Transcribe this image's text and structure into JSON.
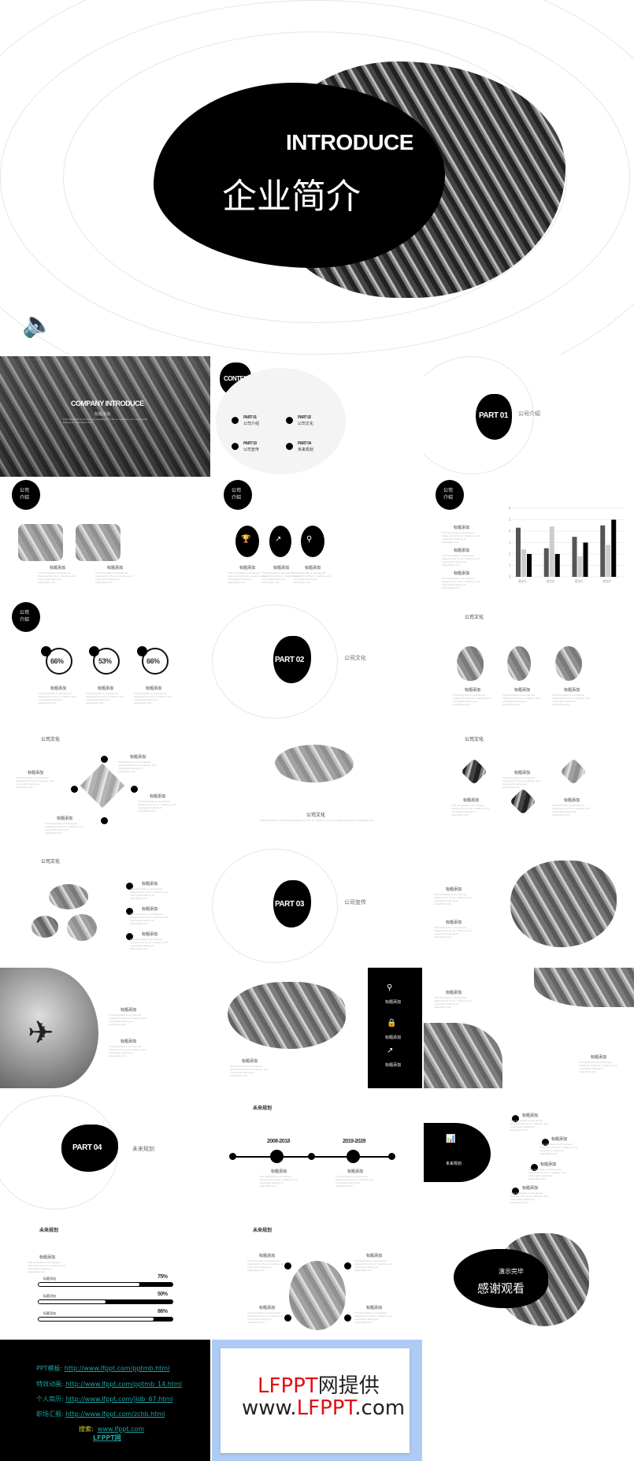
{
  "hero": {
    "title_en": "INTRODUCE",
    "title_cn": "企业简介",
    "speaker_icon": "speaker-icon"
  },
  "body_text": "This template is exclusively designed by Fei er creative, and copyrights belong to www.lfppt.com.",
  "add_title": "标题添加",
  "s1": {
    "title": "COMPANY INTRODUCE",
    "sub": "标题添加"
  },
  "s2": {
    "title": "CONTENT",
    "items": [
      {
        "part": "PART 01",
        "name": "公司介绍"
      },
      {
        "part": "PART 02",
        "name": "公司文化"
      },
      {
        "part": "PART 03",
        "name": "公司宣传"
      },
      {
        "part": "PART 04",
        "name": "未来规划"
      }
    ]
  },
  "s3": {
    "part": "PART 01",
    "name": "公司介绍"
  },
  "section_intro": "公司介绍",
  "s10": {
    "progress": [
      "66%",
      "53%",
      "66%"
    ]
  },
  "s11": {
    "part": "PART 02",
    "name": "公司文化"
  },
  "culture": "公司文化",
  "s17": {
    "part": "PART 03",
    "name": "公司宣传"
  },
  "s22": {
    "part": "PART 04",
    "name": "未来规划"
  },
  "future": "未来规划",
  "s23": {
    "years": [
      "2008-2018",
      "2019-2029"
    ]
  },
  "s24": {
    "label": "未来规划"
  },
  "s25": {
    "bars": [
      {
        "label": "标题添加",
        "value": "75%",
        "fraction": 0.75
      },
      {
        "label": "标题添加",
        "value": "50%",
        "fraction": 0.5
      },
      {
        "label": "标题添加",
        "value": "86%",
        "fraction": 0.86
      }
    ]
  },
  "s27": {
    "line1": "演示完毕",
    "line2": "感谢观看"
  },
  "links": [
    {
      "label": "PPT模板",
      "url": "http://www.lfppt.com/pptmb.html"
    },
    {
      "label": "特效动画",
      "url": "http://www.lfppt.com/pptmb_14.html"
    },
    {
      "label": "个人简历",
      "url": "http://www.lfppt.com/jldb_67.html"
    },
    {
      "label": "职场汇报",
      "url": "http://www.lfppt.com/zchb.html"
    }
  ],
  "search": {
    "label": "搜索:",
    "url": "www.lfppt.com",
    "site": "LFPPT网"
  },
  "brand": {
    "line1_red": "LFPPT",
    "line1_black": "网提供",
    "line2_pre": "www.",
    "line2_red": "LFPPT",
    "line2_post": ".com",
    "red": "#e01010",
    "frame": "#aecbf5"
  },
  "chart_data": {
    "type": "bar",
    "categories": [
      "类别1",
      "类别2",
      "类别3",
      "类别4"
    ],
    "ylim": [
      0,
      6
    ],
    "grid": true,
    "series": [
      {
        "values": [
          4.3,
          2.5,
          3.5,
          4.5
        ],
        "color": "#555555"
      },
      {
        "values": [
          2.4,
          4.4,
          1.8,
          2.8
        ],
        "color": "#cccccc"
      },
      {
        "values": [
          2,
          2,
          3,
          5
        ],
        "color": "#000000"
      }
    ]
  }
}
